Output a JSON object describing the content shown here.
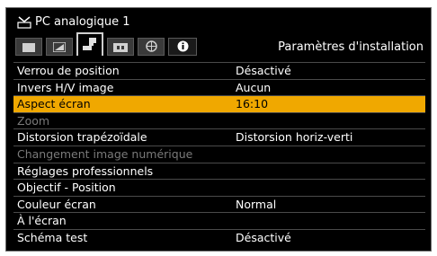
{
  "header": {
    "title": "PC analogique 1"
  },
  "tab_bar": {
    "active_title": "Paramètres d'installation",
    "tabs": [
      {
        "icon": "picture-icon"
      },
      {
        "icon": "adjust-icon"
      },
      {
        "icon": "installation-icon"
      },
      {
        "icon": "system-icon"
      },
      {
        "icon": "network-icon"
      },
      {
        "icon": "info-icon"
      }
    ]
  },
  "menu": {
    "items": [
      {
        "label": "Verrou de position",
        "value": "Désactivé"
      },
      {
        "label": "Invers H/V image",
        "value": "Aucun"
      },
      {
        "label": "Aspect écran",
        "value": "16:10"
      },
      {
        "label": "Zoom",
        "value": ""
      },
      {
        "label": "Distorsion trapézoïdale",
        "value": "Distorsion horiz-verti"
      },
      {
        "label": "Changement image numérique",
        "value": ""
      },
      {
        "label": "Réglages professionnels",
        "value": ""
      },
      {
        "label": "Objectif - Position",
        "value": ""
      },
      {
        "label": "Couleur écran",
        "value": "Normal"
      },
      {
        "label": "À l'écran",
        "value": ""
      },
      {
        "label": "Schéma test",
        "value": "Désactivé"
      }
    ]
  },
  "colors": {
    "highlight": "#f0a800",
    "background": "#000000",
    "disabled_text": "#7a7a7a"
  }
}
